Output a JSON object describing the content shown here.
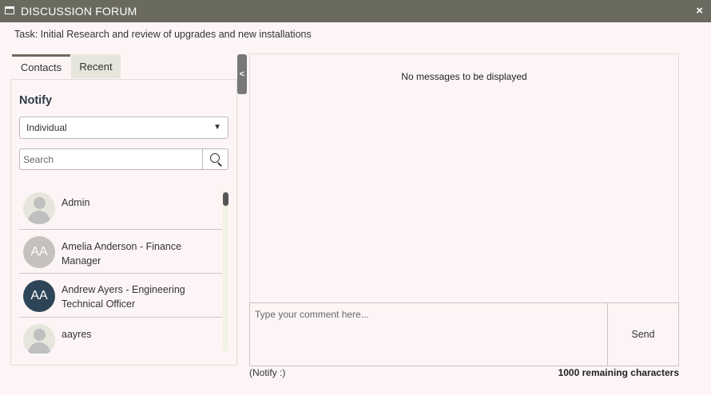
{
  "window": {
    "title": "DISCUSSION FORUM",
    "close_glyph": "×"
  },
  "task": {
    "text": "Task: Initial Research and review of upgrades and new installations"
  },
  "tabs": [
    {
      "label": "Contacts",
      "active": true
    },
    {
      "label": "Recent",
      "active": false
    }
  ],
  "notify": {
    "heading": "Notify",
    "select_value": "Individual",
    "search_placeholder": "Search"
  },
  "contacts": [
    {
      "name": "Admin",
      "avatar": "generic",
      "initials": ""
    },
    {
      "name": "Amelia Anderson - Finance Manager",
      "avatar": "light",
      "initials": "AA"
    },
    {
      "name": "Andrew Ayers - Engineering Technical Officer",
      "avatar": "dark",
      "initials": "AA"
    },
    {
      "name": "aayres",
      "avatar": "generic",
      "initials": ""
    }
  ],
  "collapse_glyph": "<",
  "messages": {
    "empty_text": "No messages to be displayed"
  },
  "comment": {
    "placeholder": "Type your comment here...",
    "send_label": "Send"
  },
  "footer": {
    "notify_text": "(Notify :)",
    "remaining_text": "1000 remaining characters"
  },
  "colors": {
    "titlebar": "#6b6a5e",
    "background": "#fdf5f5",
    "avatar_dark": "#2e4457",
    "avatar_light": "#c5c1be"
  },
  "icons": {
    "window": "window-icon",
    "close": "close-icon",
    "search": "search-icon",
    "caret": "caret-down-icon"
  }
}
